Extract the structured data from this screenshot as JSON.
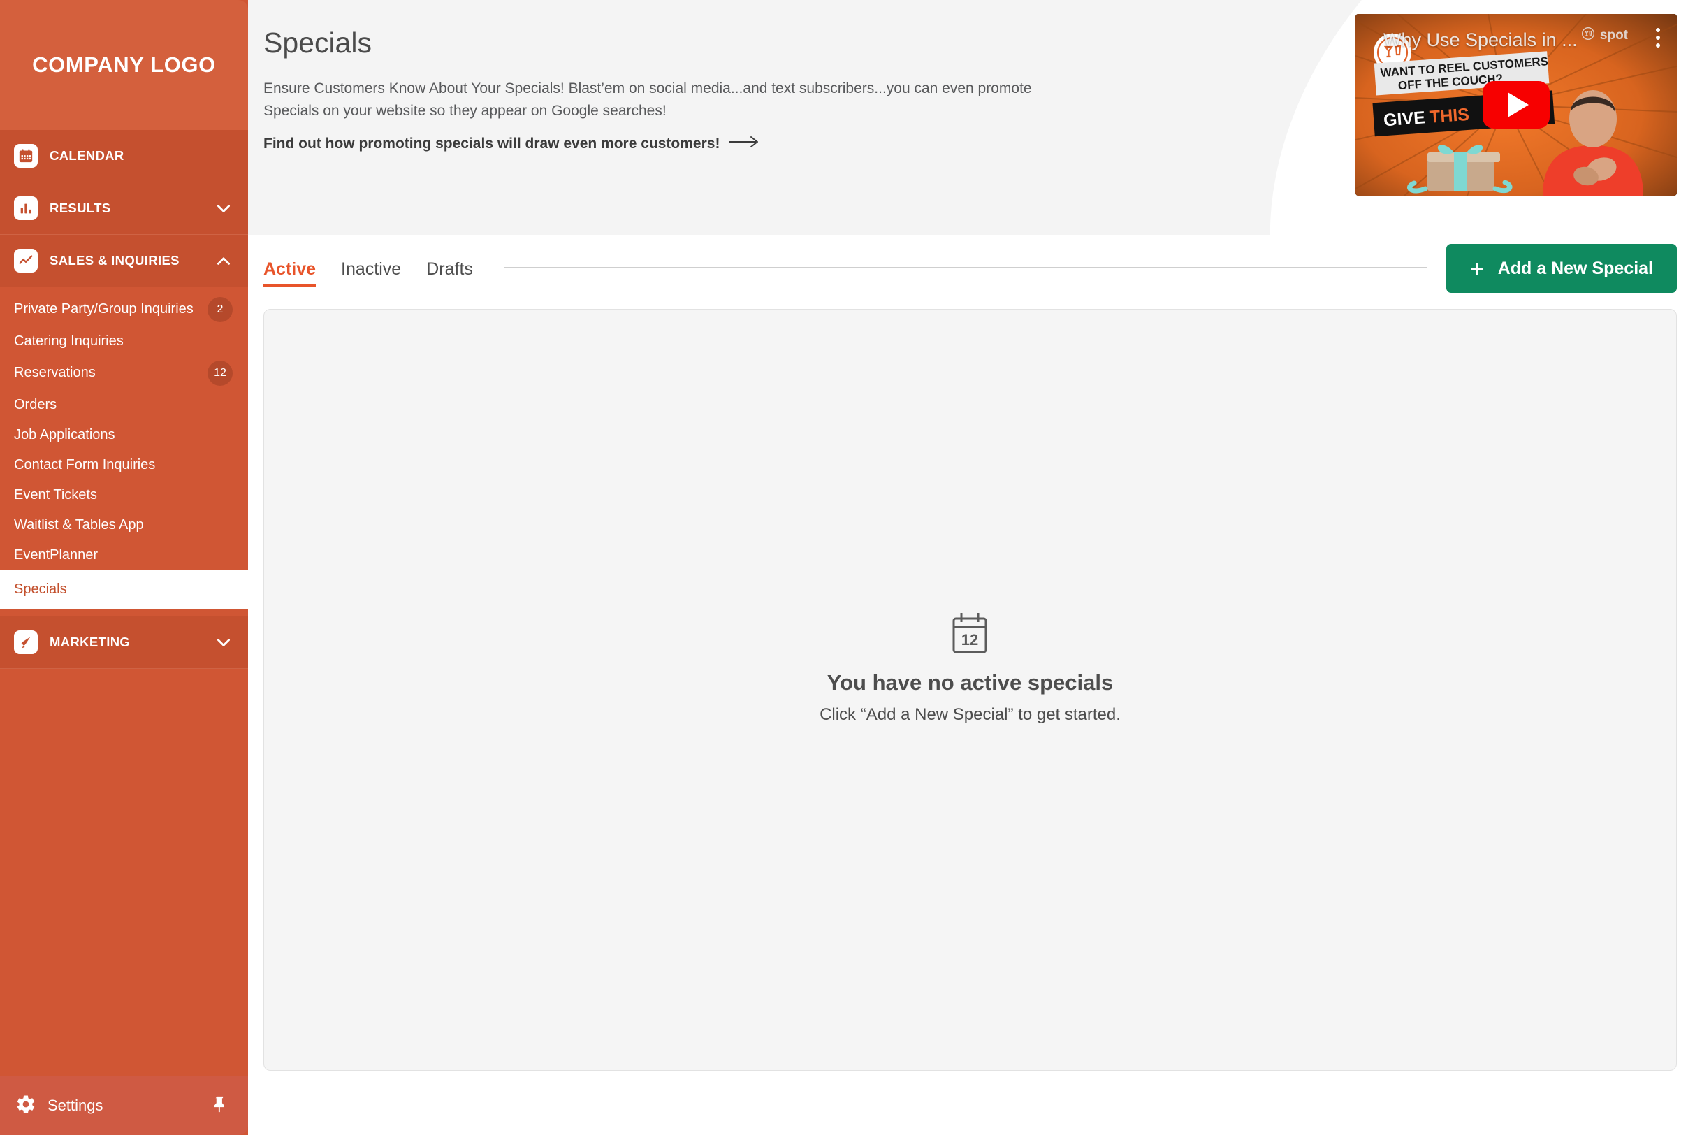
{
  "sidebar": {
    "logo": "COMPANY LOGO",
    "groups": [
      {
        "id": "calendar",
        "label": "CALENDAR",
        "icon": "calendar-icon",
        "expandable": false,
        "chevron": ""
      },
      {
        "id": "results",
        "label": "RESULTS",
        "icon": "bar-chart-icon",
        "expandable": true,
        "chevron": "down"
      },
      {
        "id": "sales-inquiries",
        "label": "SALES & INQUIRIES",
        "icon": "line-chart-icon",
        "expandable": true,
        "chevron": "up"
      }
    ],
    "sales_items": [
      {
        "label": "Private Party/Group Inquiries",
        "badge": "2",
        "active": false
      },
      {
        "label": "Catering Inquiries",
        "badge": "",
        "active": false
      },
      {
        "label": "Reservations",
        "badge": "12",
        "active": false
      },
      {
        "label": "Orders",
        "badge": "",
        "active": false
      },
      {
        "label": "Job Applications",
        "badge": "",
        "active": false
      },
      {
        "label": "Contact Form Inquiries",
        "badge": "",
        "active": false
      },
      {
        "label": "Event Tickets",
        "badge": "",
        "active": false
      },
      {
        "label": "Waitlist & Tables App",
        "badge": "",
        "active": false
      },
      {
        "label": "EventPlanner",
        "badge": "",
        "active": false
      },
      {
        "label": "Specials",
        "badge": "",
        "active": true
      }
    ],
    "marketing": {
      "id": "marketing",
      "label": "MARKETING",
      "icon": "megaphone-icon",
      "chevron": "down"
    },
    "settings": {
      "label": "Settings",
      "icon": "gear-icon",
      "pin_icon": "pin-icon"
    }
  },
  "header": {
    "title": "Specials",
    "description": "Ensure Customers Know About Your Specials! Blast’em on social media...and text subscribers...you can even promote Specials on your website so they appear on Google searches!",
    "link_text": "Find out how promoting specials will draw even more customers!",
    "link_arrow_icon": "arrow-right-icon"
  },
  "video": {
    "title": "Why Use Specials in ...",
    "brand": "spot",
    "brand_icon": "cocktail-glasses-icon",
    "play_icon": "youtube-play-icon",
    "menu_icon": "kebab-menu-icon",
    "overlay_line1": "WANT TO REEL CUSTOMERS",
    "overlay_line2": "OFF THE COUCH?",
    "overlay_line3a": "GIVE",
    "overlay_line3b": "THIS"
  },
  "tabs": [
    {
      "id": "active",
      "label": "Active",
      "selected": true
    },
    {
      "id": "inactive",
      "label": "Inactive",
      "selected": false
    },
    {
      "id": "drafts",
      "label": "Drafts",
      "selected": false
    }
  ],
  "toolbar": {
    "add_label": "Add a New Special",
    "add_icon": "plus-icon"
  },
  "empty_state": {
    "icon": "calendar-12-icon",
    "icon_day": "12",
    "title": "You have no active specials",
    "subtitle": "Click “Add a New Special” to get started."
  },
  "colors": {
    "sidebar_bg": "#d05634",
    "sidebar_group_bg": "#c5502f",
    "sidebar_logo_bg": "#d4603d",
    "accent_orange": "#e8542a",
    "accent_green": "#0f8a5f",
    "badge_bg": "#b5492b",
    "header_bg": "#f4f4f4",
    "card_bg": "#f5f5f5",
    "active_item_text": "#c3502d"
  }
}
